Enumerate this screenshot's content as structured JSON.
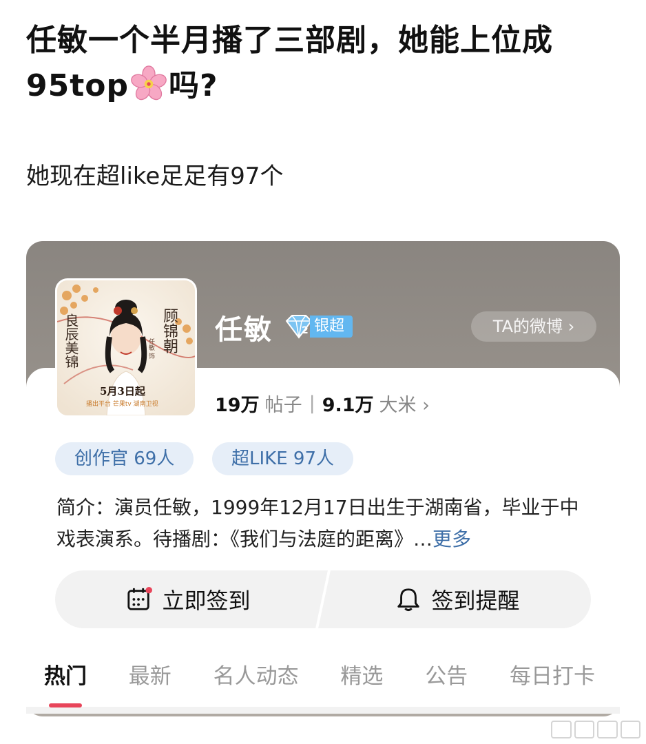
{
  "post": {
    "title_part1": "任敏一个半月播了三部剧，她能上位成95top",
    "title_part2": "吗?",
    "body": "她现在超like足足有97个"
  },
  "topic": {
    "name": "任敏",
    "level_label": "银超",
    "level_number": "2",
    "weibo_button": "TA的微博 ›",
    "posts_count": "19万",
    "posts_label": "帖子",
    "separator": "|",
    "members_count": "9.1万",
    "members_label": "大米 ›",
    "pills": [
      {
        "label": "创作官 69人"
      },
      {
        "label": "超LIKE 97人"
      }
    ],
    "intro_text": "简介：演员任敏，1999年12月17日出生于湖南省，毕业于中戏表演系。待播剧：《我们与法庭的距离》…",
    "intro_more": "更多"
  },
  "avatar": {
    "drama_title": "顾锦朝",
    "actor_note": "任敏 饰",
    "calligraphy": "良辰美锦",
    "date": "5月3日起",
    "platforms": "播出平台 芒果tv 湖南卫视"
  },
  "actions": {
    "checkin": "立即签到",
    "reminder": "签到提醒"
  },
  "tabs": [
    "热门",
    "最新",
    "名人动态",
    "精选",
    "公告",
    "每日打卡"
  ],
  "colors": {
    "accent_blue": "#3e6fa8",
    "tab_indicator": "#e8455a",
    "badge_blue": "#62b7f0"
  }
}
